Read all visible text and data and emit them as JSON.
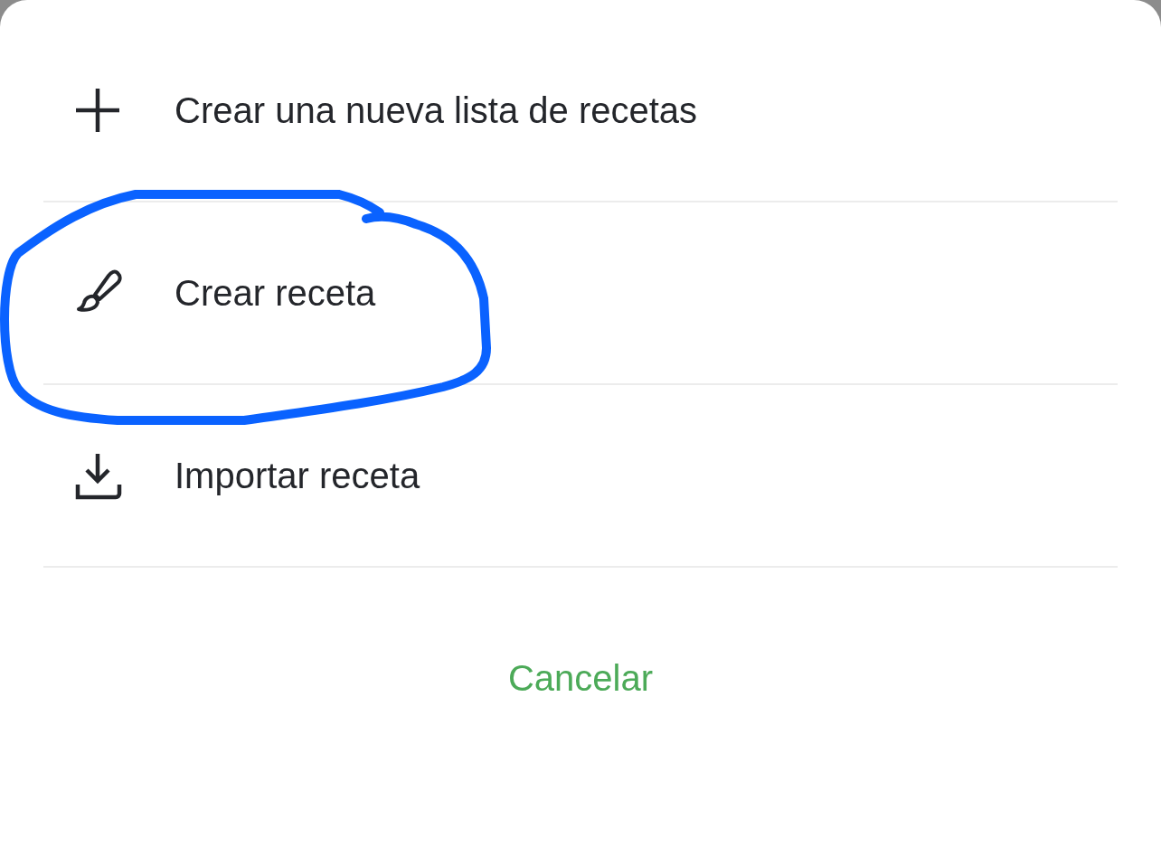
{
  "menu": {
    "items": [
      {
        "kind": "plus",
        "label": "Crear una nueva lista de recetas",
        "circled": false
      },
      {
        "kind": "brush",
        "label": "Crear receta",
        "circled": true
      },
      {
        "kind": "download",
        "label": "Importar receta",
        "circled": false
      }
    ]
  },
  "cancel_button": {
    "label": "Cancelar"
  }
}
